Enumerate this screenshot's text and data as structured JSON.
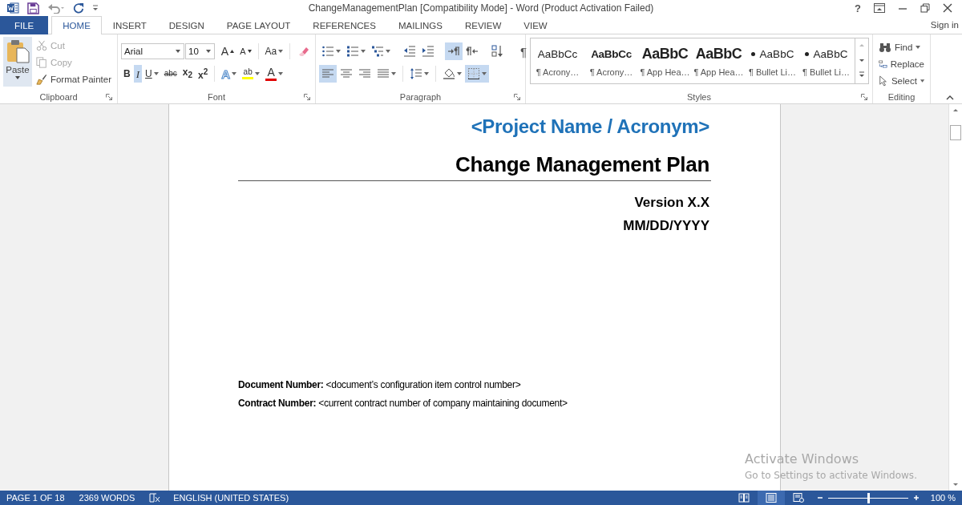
{
  "window": {
    "title": "ChangeManagementPlan [Compatibility Mode] - Word (Product Activation Failed)",
    "help": "?"
  },
  "tabs": [
    {
      "label": "FILE",
      "kind": "backstage",
      "selected": false
    },
    {
      "label": "HOME",
      "kind": "tab",
      "selected": true
    },
    {
      "label": "INSERT",
      "kind": "tab",
      "selected": false
    },
    {
      "label": "DESIGN",
      "kind": "tab",
      "selected": false
    },
    {
      "label": "PAGE LAYOUT",
      "kind": "tab",
      "selected": false
    },
    {
      "label": "REFERENCES",
      "kind": "tab",
      "selected": false
    },
    {
      "label": "MAILINGS",
      "kind": "tab",
      "selected": false
    },
    {
      "label": "REVIEW",
      "kind": "tab",
      "selected": false
    },
    {
      "label": "VIEW",
      "kind": "tab",
      "selected": false
    }
  ],
  "sign_in": "Sign in",
  "clipboard": {
    "label": "Clipboard",
    "paste": "Paste",
    "tools": [
      {
        "kind": "cut",
        "label": "Cut",
        "disabled": true
      },
      {
        "kind": "copy",
        "label": "Copy",
        "disabled": true
      },
      {
        "kind": "format-painter",
        "label": "Format Painter",
        "disabled": false
      }
    ]
  },
  "font": {
    "label": "Font",
    "font_name": "Arial",
    "font_size": "10",
    "sizing": [
      [
        {
          "kind": "grow",
          "label": "A",
          "dropdown": false
        },
        {
          "kind": "shrink",
          "label": "A",
          "dropdown": false
        }
      ],
      [
        {
          "kind": "change-case",
          "label": "Aa",
          "dropdown": true
        }
      ],
      [
        {
          "kind": "clear",
          "dropdown": false
        }
      ]
    ],
    "formatting": [
      [
        {
          "kind": "bold",
          "label": "B",
          "selected": false,
          "dropdown": false
        },
        {
          "kind": "italic",
          "label": "I",
          "selected": true,
          "dropdown": false
        },
        {
          "kind": "underline",
          "label": "U",
          "selected": false,
          "dropdown": true
        },
        {
          "kind": "strike",
          "label": "abc",
          "selected": false,
          "dropdown": false
        },
        {
          "kind": "subscript",
          "label": "x$_{2}$",
          "selected": false,
          "dropdown": false
        },
        {
          "kind": "superscript",
          "label": "x$^{2}$",
          "selected": false,
          "dropdown": false
        }
      ],
      [
        {
          "kind": "text-effects",
          "label": "A",
          "selected": false,
          "dropdown": true
        },
        {
          "kind": "highlight",
          "label": "ab",
          "selected": false,
          "dropdown": true,
          "color": "#ffff00"
        },
        {
          "kind": "font-color",
          "label": "A",
          "selected": false,
          "dropdown": true,
          "color": "#e00000"
        }
      ]
    ]
  },
  "paragraph": {
    "label": "Paragraph",
    "rows": [
      [
        [
          {
            "kind": "bullets",
            "selected": false,
            "dropdown": true
          },
          {
            "kind": "numbering",
            "selected": false,
            "dropdown": true
          },
          {
            "kind": "multilevel",
            "selected": false,
            "dropdown": true
          }
        ],
        [
          {
            "kind": "decrease-indent",
            "selected": false,
            "dropdown": false
          },
          {
            "kind": "increase-indent",
            "selected": false,
            "dropdown": false
          }
        ],
        [
          {
            "kind": "ltr",
            "selected": true,
            "dropdown": false
          },
          {
            "kind": "rtl",
            "selected": false,
            "dropdown": false
          }
        ],
        [
          {
            "kind": "sort",
            "selected": false,
            "dropdown": false
          }
        ],
        [
          {
            "kind": "show-marks",
            "label": "¶",
            "selected": false,
            "dropdown": false
          }
        ]
      ],
      [
        [
          {
            "kind": "align-left",
            "selected": true,
            "dropdown": false
          },
          {
            "kind": "center",
            "selected": false,
            "dropdown": false
          },
          {
            "kind": "align-right",
            "selected": false,
            "dropdown": false
          },
          {
            "kind": "justify",
            "selected": false,
            "dropdown": true
          }
        ],
        [
          {
            "kind": "line-spacing",
            "selected": false,
            "dropdown": true
          }
        ],
        [
          {
            "kind": "shading",
            "selected": false,
            "dropdown": true
          },
          {
            "kind": "borders",
            "selected": true,
            "dropdown": true
          }
        ]
      ]
    ]
  },
  "styles": {
    "label": "Styles",
    "items": [
      {
        "kind": "normal",
        "preview": "AaBbCc",
        "name": "¶ Acrony…"
      },
      {
        "kind": "strong",
        "preview": "AaBbCc",
        "name": "¶ Acrony…"
      },
      {
        "kind": "heading",
        "preview": "AaBbC",
        "name": "¶ App Hea…"
      },
      {
        "kind": "heading",
        "preview": "AaBbC",
        "name": "¶ App Hea…"
      },
      {
        "kind": "bullet",
        "preview": "AaBbC",
        "name": "¶ Bullet Li…"
      },
      {
        "kind": "bullet",
        "preview": "AaBbC",
        "name": "¶ Bullet Li…"
      }
    ]
  },
  "editing": {
    "label": "Editing",
    "tools": [
      {
        "kind": "find",
        "label": "Find",
        "dropdown": true
      },
      {
        "kind": "replace",
        "label": "Replace",
        "dropdown": false
      },
      {
        "kind": "select",
        "label": "Select",
        "dropdown": true
      }
    ]
  },
  "document": {
    "project_name": "<Project Name / Acronym>",
    "title": "Change Management Plan",
    "version": "Version X.X",
    "date": "MM/DD/YYYY",
    "fields": [
      "**Document Number:** <document’s configuration item control number>",
      "**Contract Number:** <current contract number of company maintaining document>"
    ]
  },
  "activation": {
    "title": "Activate Windows",
    "hint": "Go to Settings to activate Windows."
  },
  "status_bar": {
    "page": "PAGE 1 OF 18",
    "words": "2369 WORDS",
    "language": "ENGLISH (UNITED STATES)",
    "views": [
      {
        "kind": "read",
        "selected": false
      },
      {
        "kind": "print",
        "selected": true
      },
      {
        "kind": "web",
        "selected": false
      }
    ],
    "zoom": {
      "level": 0.5,
      "reading": "100 %"
    }
  }
}
